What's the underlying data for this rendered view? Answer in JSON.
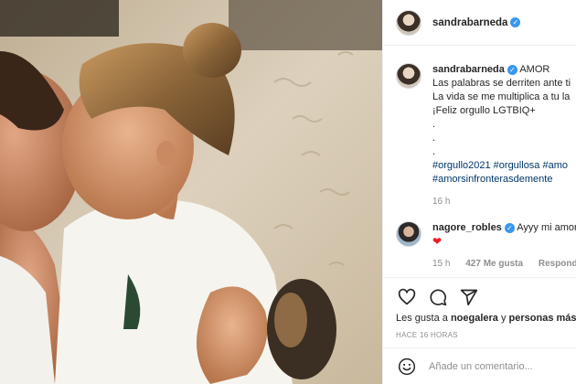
{
  "header": {
    "username": "sandrabarneda",
    "verified_glyph": "✓"
  },
  "post": {
    "caption_user": "sandrabarneda",
    "caption_first": "AMOR",
    "caption_lines": [
      "Las palabras se derriten ante ti",
      "La vida se me multiplica a tu la",
      "¡Feliz orgullo LGTBIQ+",
      ".",
      ".",
      "."
    ],
    "hashtags_line1": "#orgullo2021 #orgullosa #amo",
    "hashtags_line2": "#amorsinfronterasdemente",
    "caption_time": "16 h"
  },
  "comment": {
    "user": "nagore_robles",
    "text": "Ayyy mi amor",
    "emoji": "❤",
    "time": "15 h",
    "likes": "427 Me gusta",
    "reply": "Responder"
  },
  "actions": {
    "icons": [
      "heart-icon",
      "comment-icon",
      "share-icon"
    ],
    "likes_prefix": "Les gusta a",
    "likes_user": "noegalera",
    "likes_conj": "y",
    "likes_rest": "personas más",
    "time_ago": "HACE 16 HORAS"
  },
  "add_comment": {
    "placeholder": "Añade un comentario..."
  },
  "colors": {
    "verified": "#3897f0",
    "hashtag": "#00376b",
    "muted": "#8e8e8e"
  }
}
